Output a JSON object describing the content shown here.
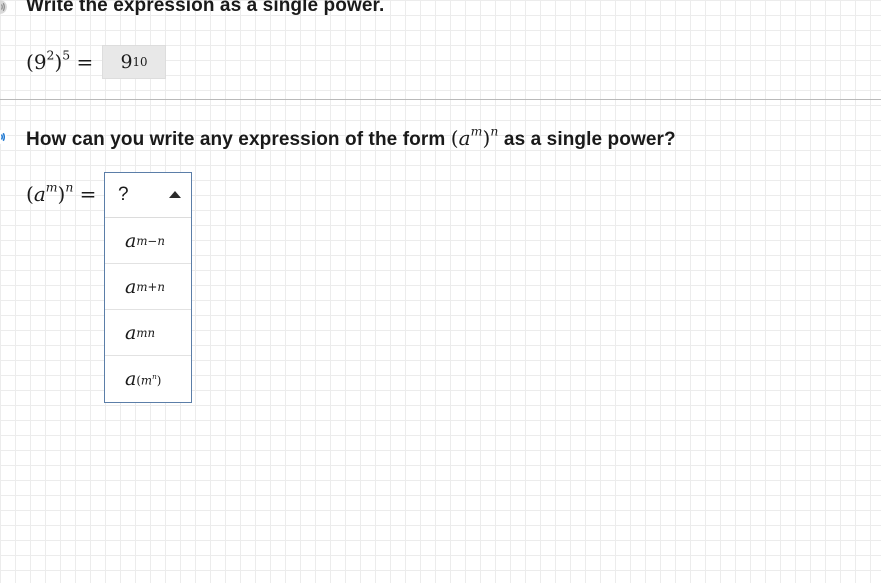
{
  "question1": {
    "prompt": "Write the expression as a single power.",
    "lhs": {
      "base": "9",
      "inner_exp": "2",
      "outer_exp": "5"
    },
    "answer": {
      "base": "9",
      "exp": "10"
    }
  },
  "question2": {
    "prompt_before": "How can you write any expression of the form",
    "prompt_math": {
      "base": "a",
      "inner_exp": "m",
      "outer_exp": "n"
    },
    "prompt_after": "as a single power?",
    "lhs": {
      "base": "a",
      "inner_exp": "m",
      "outer_exp": "n"
    },
    "dropdown": {
      "selected": "?",
      "options": [
        {
          "base": "a",
          "exp": "m−n"
        },
        {
          "base": "a",
          "exp": "m+n"
        },
        {
          "base": "a",
          "exp": "mn"
        },
        {
          "base": "a",
          "exp_base": "m",
          "exp_exp": "n"
        }
      ]
    }
  },
  "colors": {
    "audio_icon_inactive": "#cfcfcf",
    "audio_icon_active": "#1f78d1",
    "dropdown_border": "#5b7ea8"
  },
  "icons": {
    "audio_1": "speaker-icon",
    "audio_2": "speaker-icon",
    "dropdown_caret": "caret-up-icon"
  }
}
